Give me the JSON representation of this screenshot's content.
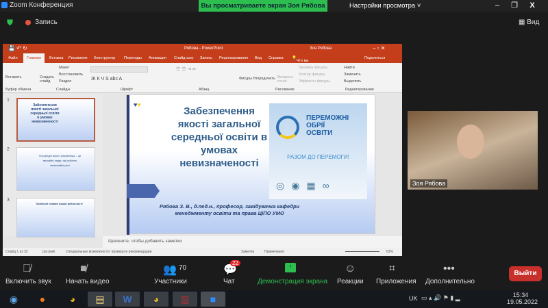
{
  "window": {
    "title": "Zoom Конференция",
    "banner": "Вы просматриваете экран Зоя Рябова",
    "view_settings": "Настройки просмотра",
    "minimize": "–",
    "restore": "❐",
    "close": "X"
  },
  "topbar": {
    "record": "Запись",
    "view": "Вид"
  },
  "ppt": {
    "title": "Рябова - PowerPoint",
    "user": "Зоя Рябова",
    "tabs": [
      "Файл",
      "Главная",
      "Вставка",
      "Рисование",
      "Конструктор",
      "Переходы",
      "Анимация",
      "Слайд-шоу",
      "Запись",
      "Рецензирование",
      "Вид",
      "Справка"
    ],
    "tell_me": "Что вы хотите сделать?",
    "share": "Поделиться",
    "ribbon": {
      "paste": "Вставить",
      "new_slide": "Создать слайд",
      "layout": "Макет",
      "reset": "Восстановить",
      "section": "Раздел",
      "shapes": "Фигуры",
      "arrange": "Упорядочить",
      "quick_styles": "Экспресс-стили",
      "fill": "Заливка фигуры",
      "outline": "Контур фигуры",
      "effects": "Эффекты фигуры",
      "find": "Найти",
      "replace": "Заменить",
      "select": "Выделить",
      "groups": [
        "Буфер обмена",
        "Слайды",
        "Шрифт",
        "Абзац",
        "Рисование",
        "Редактирование"
      ]
    },
    "thumbs": [
      {
        "n": "1",
        "text": "Забезпечення якості загальної середньої освіти в умовах невизначеності"
      },
      {
        "n": "2",
        "text": "Посередні якості управлінця – це звичайні люди, які роблять незвичайні речі"
      },
      {
        "n": "3",
        "text": "Зовнішні ознаки нашої реальності"
      }
    ],
    "slide": {
      "title": "Забезпечення якості загальної середньої освіти в умовах невизначеності",
      "logo_l1": "ПЕРЕМОЖНІ",
      "logo_l2": "ОБРІЇ",
      "logo_l3": "ОСВІТИ",
      "slogan": "РАЗОМ ДО ПЕРЕМОГИ!",
      "author": "Рябова З. В., д.пед.н., професор, завідувачка кафедри менеджменту освіти та права ЦІПО УМО"
    },
    "notes_placeholder": "Щелкните, чтобы добавить заметки",
    "status": {
      "slide": "Слайд 1 из 32",
      "lang": "русский",
      "access": "Специальные возможности: проверьте рекомендации",
      "notes": "Заметки",
      "comments": "Примечания",
      "zoom": "63%"
    }
  },
  "video": {
    "name": "Зоя Рябова"
  },
  "toolbar": {
    "audio": "Включить звук",
    "video": "Начать видео",
    "participants": "Участники",
    "participants_count": "70",
    "chat": "Чат",
    "chat_badge": "22",
    "share": "Демонстрация экрана",
    "reactions": "Реакции",
    "apps": "Приложения",
    "more": "Дополнительно",
    "leave": "Выйти"
  },
  "taskbar": {
    "lang": "UK",
    "time": "15:34",
    "date": "19.05.2022"
  },
  "colors": {
    "ppt": "#c43e1c",
    "share": "#2dbe4f",
    "leave": "#c8302c"
  }
}
